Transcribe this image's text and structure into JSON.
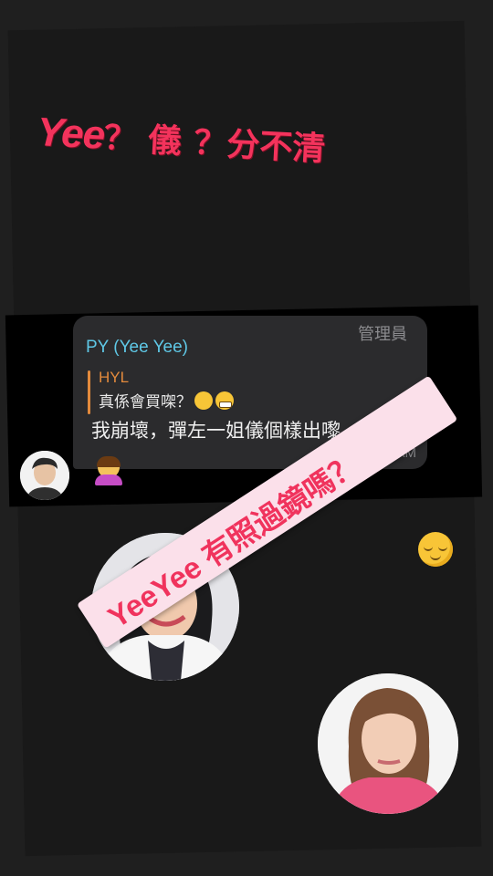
{
  "headline": {
    "part1": "Yee",
    "part2": "？ 儀",
    "part3": "？分不清"
  },
  "chat": {
    "sender": "PY (Yee Yee)",
    "role": "管理員",
    "quote_author": "HYL",
    "quote_text": "真係會買㗎？",
    "message": "我崩壞，彈左一姐儀個樣出嚟",
    "time": "3:12 AM"
  },
  "banner": {
    "text": "YeeYee 有照過鏡嗎？"
  },
  "icons": {
    "quote_emojis": [
      "hand-over-mouth-emoji-icon",
      "grimacing-emoji-icon"
    ],
    "message_emoji": "facepalm-emoji-icon",
    "banner_emoji": "relieved-emoji-icon"
  },
  "colors": {
    "accent_red": "#f3335c",
    "sender_blue": "#5fc8e6",
    "quote_orange": "#e38a3c",
    "bubble": "#2b2b2d",
    "banner_pink": "#fbe0ea"
  }
}
